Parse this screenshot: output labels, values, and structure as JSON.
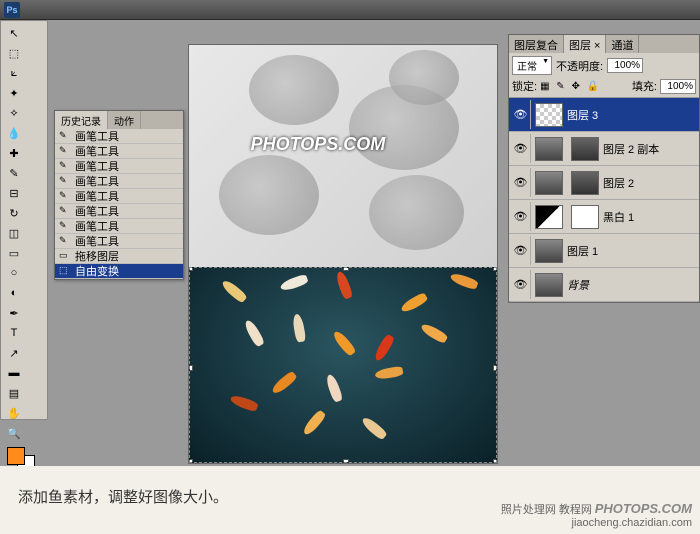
{
  "app": {
    "logo": "Ps"
  },
  "history": {
    "tabs": [
      "历史记录",
      "动作"
    ],
    "items": [
      {
        "icon": "✎",
        "label": "画笔工具"
      },
      {
        "icon": "✎",
        "label": "画笔工具"
      },
      {
        "icon": "✎",
        "label": "画笔工具"
      },
      {
        "icon": "✎",
        "label": "画笔工具"
      },
      {
        "icon": "✎",
        "label": "画笔工具"
      },
      {
        "icon": "✎",
        "label": "画笔工具"
      },
      {
        "icon": "✎",
        "label": "画笔工具"
      },
      {
        "icon": "✎",
        "label": "画笔工具"
      },
      {
        "icon": "▭",
        "label": "拖移图层"
      },
      {
        "icon": "⬚",
        "label": "自由变换",
        "selected": true
      }
    ]
  },
  "watermark": "PHOTOPS.COM",
  "watermark_sub": "照片处理网",
  "layers": {
    "tabs": [
      "图层复合",
      "图层 ×",
      "通道"
    ],
    "blend_label": "正常",
    "opacity_label": "不透明度:",
    "opacity_value": "100%",
    "lock_label": "锁定:",
    "fill_label": "填充:",
    "fill_value": "100%",
    "items": [
      {
        "name": "图层 3",
        "selected": true,
        "thumb": "checker"
      },
      {
        "name": "图层 2 副本",
        "double": true
      },
      {
        "name": "图层 2",
        "double": true
      },
      {
        "name": "黑白 1",
        "adj": true
      },
      {
        "name": "图层 1"
      },
      {
        "name": "背景",
        "italic": true
      }
    ]
  },
  "caption": "添加鱼素材，调整好图像大小。",
  "footer": {
    "site": "PHOTOPS.COM",
    "sub": "照片处理网 教程网",
    "url": "jiaocheng.chazidian.com"
  },
  "colors": {
    "fg": "#ff8c1a",
    "bg": "#ffffff"
  }
}
